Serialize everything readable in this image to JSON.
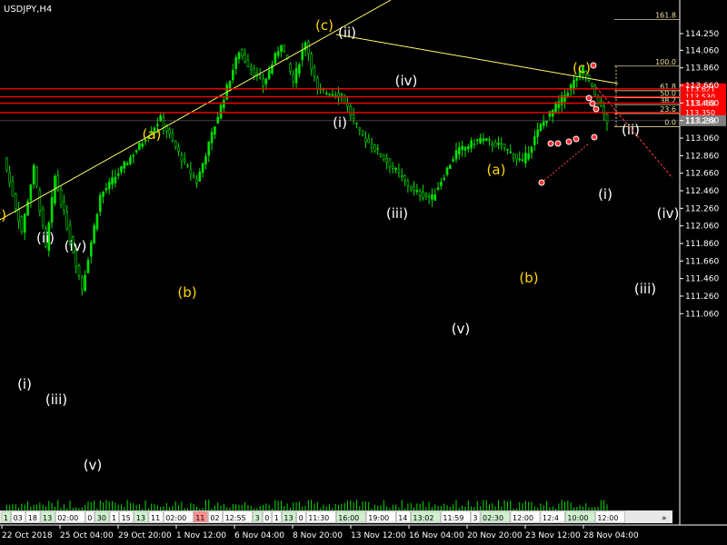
{
  "symbol_label": "USDJPY,H4",
  "colors": {
    "background": "#000000",
    "candle": "#00e000",
    "grid": "#1a1a1a",
    "axis": "#ffffff",
    "trendline": "#ffff66",
    "fibo": "#d8d090",
    "hline": "#ff0000",
    "wave_white": "#ffffff",
    "wave_yellow": "#ffd700",
    "bid_tag": "#808080"
  },
  "price_axis": {
    "ticks": [
      "114.250",
      "114.060",
      "113.860",
      "113.660",
      "113.460",
      "113.260",
      "113.060",
      "112.860",
      "112.660",
      "112.460",
      "112.260",
      "112.060",
      "111.860",
      "111.660",
      "111.460",
      "111.260",
      "111.060"
    ],
    "hlines": [
      {
        "label": "113.621",
        "value": 113.621
      },
      {
        "label": "113.530",
        "value": 113.53
      },
      {
        "label": "113.458",
        "value": 113.458
      },
      {
        "label": "113.350",
        "value": 113.35
      }
    ],
    "bid_label": "113.258",
    "bid_value": 113.258
  },
  "time_axis": {
    "labels": [
      "22 Oct 2018",
      "25 Oct 04:00",
      "29 Oct 20:00",
      "1 Nov 12:00",
      "6 Nov 04:00",
      "8 Nov 20:00",
      "13 Nov 12:00",
      "16 Nov 04:00",
      "20 Nov 20:00",
      "23 Nov 12:00",
      "28 Nov 04:00"
    ],
    "scrollbar_fragments": [
      "1",
      "03",
      "18",
      "13",
      "02:00",
      "0",
      "30",
      "1",
      "15",
      "13",
      "11",
      "02:00",
      "11",
      "02",
      "12:55",
      "3",
      "0",
      "1",
      "13",
      "0",
      "11:30",
      "16:00",
      "19:00",
      "14",
      "13:02",
      "11:59",
      "3",
      "02:30",
      "12:00",
      "12:4",
      "10:00",
      "12:00"
    ]
  },
  "fibo_levels": [
    {
      "label": "161.8",
      "value": 114.41
    },
    {
      "label": "100.0",
      "value": 113.88
    },
    {
      "label": "61.8",
      "value": 113.6
    },
    {
      "label": "50.0",
      "value": 113.52
    },
    {
      "label": "38.2",
      "value": 113.44
    },
    {
      "label": "23.6",
      "value": 113.34
    },
    {
      "label": "0.0",
      "value": 113.19
    }
  ],
  "wave_labels": [
    {
      "text": "c)",
      "color": "yellow"
    },
    {
      "text": "(ii)",
      "color": "white"
    },
    {
      "text": "(iv)",
      "color": "white"
    },
    {
      "text": "(i)",
      "color": "white"
    },
    {
      "text": "(iii)",
      "color": "white"
    },
    {
      "text": "(v)",
      "color": "white"
    },
    {
      "text": "(a)",
      "color": "yellow"
    },
    {
      "text": "(b)",
      "color": "yellow"
    },
    {
      "text": "(c)",
      "color": "yellow"
    },
    {
      "text": "(ii)",
      "color": "white"
    },
    {
      "text": "(iv)",
      "color": "white"
    },
    {
      "text": "(i)",
      "color": "white"
    },
    {
      "text": "(iii)",
      "color": "white"
    },
    {
      "text": "(v)",
      "color": "white"
    },
    {
      "text": "(a)",
      "color": "yellow"
    },
    {
      "text": "(b)",
      "color": "yellow"
    },
    {
      "text": "(c)",
      "color": "yellow"
    },
    {
      "text": "(ii)",
      "color": "white"
    },
    {
      "text": "(i)",
      "color": "white"
    },
    {
      "text": "(iv)",
      "color": "white"
    },
    {
      "text": "(iii)",
      "color": "white"
    }
  ],
  "swing_points": [
    {
      "t": 0,
      "price": 112.83
    },
    {
      "t": 6,
      "price": 112.0
    },
    {
      "t": 10,
      "price": 112.72
    },
    {
      "t": 14,
      "price": 111.8
    },
    {
      "t": 17,
      "price": 112.62
    },
    {
      "t": 26,
      "price": 111.35
    },
    {
      "t": 32,
      "price": 112.4
    },
    {
      "t": 40,
      "price": 112.75
    },
    {
      "t": 52,
      "price": 113.28
    },
    {
      "t": 60,
      "price": 112.76
    },
    {
      "t": 64,
      "price": 112.56
    },
    {
      "t": 72,
      "price": 113.42
    },
    {
      "t": 78,
      "price": 114.05
    },
    {
      "t": 86,
      "price": 113.66
    },
    {
      "t": 92,
      "price": 114.15
    },
    {
      "t": 96,
      "price": 113.7
    },
    {
      "t": 100,
      "price": 114.17
    },
    {
      "t": 104,
      "price": 113.6
    },
    {
      "t": 112,
      "price": 113.55
    },
    {
      "t": 118,
      "price": 113.12
    },
    {
      "t": 128,
      "price": 112.76
    },
    {
      "t": 136,
      "price": 112.45
    },
    {
      "t": 142,
      "price": 112.38
    },
    {
      "t": 150,
      "price": 112.9
    },
    {
      "t": 158,
      "price": 113.05
    },
    {
      "t": 166,
      "price": 112.95
    },
    {
      "t": 172,
      "price": 112.78
    },
    {
      "t": 178,
      "price": 113.2
    },
    {
      "t": 186,
      "price": 113.55
    },
    {
      "t": 192,
      "price": 113.85
    },
    {
      "t": 196,
      "price": 113.55
    },
    {
      "t": 200,
      "price": 113.25
    }
  ]
}
